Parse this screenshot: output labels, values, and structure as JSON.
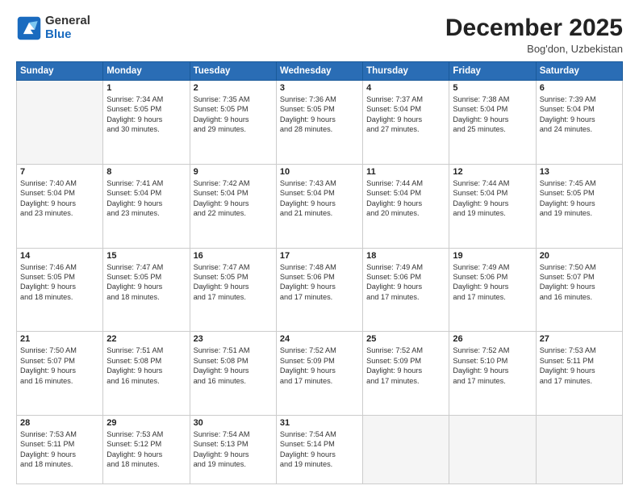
{
  "header": {
    "logo_general": "General",
    "logo_blue": "Blue",
    "month_title": "December 2025",
    "location": "Bog'don, Uzbekistan"
  },
  "days_of_week": [
    "Sunday",
    "Monday",
    "Tuesday",
    "Wednesday",
    "Thursday",
    "Friday",
    "Saturday"
  ],
  "weeks": [
    [
      {
        "day": "",
        "lines": [],
        "empty": true
      },
      {
        "day": "1",
        "lines": [
          "Sunrise: 7:34 AM",
          "Sunset: 5:05 PM",
          "Daylight: 9 hours",
          "and 30 minutes."
        ]
      },
      {
        "day": "2",
        "lines": [
          "Sunrise: 7:35 AM",
          "Sunset: 5:05 PM",
          "Daylight: 9 hours",
          "and 29 minutes."
        ]
      },
      {
        "day": "3",
        "lines": [
          "Sunrise: 7:36 AM",
          "Sunset: 5:05 PM",
          "Daylight: 9 hours",
          "and 28 minutes."
        ]
      },
      {
        "day": "4",
        "lines": [
          "Sunrise: 7:37 AM",
          "Sunset: 5:04 PM",
          "Daylight: 9 hours",
          "and 27 minutes."
        ]
      },
      {
        "day": "5",
        "lines": [
          "Sunrise: 7:38 AM",
          "Sunset: 5:04 PM",
          "Daylight: 9 hours",
          "and 25 minutes."
        ]
      },
      {
        "day": "6",
        "lines": [
          "Sunrise: 7:39 AM",
          "Sunset: 5:04 PM",
          "Daylight: 9 hours",
          "and 24 minutes."
        ]
      }
    ],
    [
      {
        "day": "7",
        "lines": [
          "Sunrise: 7:40 AM",
          "Sunset: 5:04 PM",
          "Daylight: 9 hours",
          "and 23 minutes."
        ]
      },
      {
        "day": "8",
        "lines": [
          "Sunrise: 7:41 AM",
          "Sunset: 5:04 PM",
          "Daylight: 9 hours",
          "and 23 minutes."
        ]
      },
      {
        "day": "9",
        "lines": [
          "Sunrise: 7:42 AM",
          "Sunset: 5:04 PM",
          "Daylight: 9 hours",
          "and 22 minutes."
        ]
      },
      {
        "day": "10",
        "lines": [
          "Sunrise: 7:43 AM",
          "Sunset: 5:04 PM",
          "Daylight: 9 hours",
          "and 21 minutes."
        ]
      },
      {
        "day": "11",
        "lines": [
          "Sunrise: 7:44 AM",
          "Sunset: 5:04 PM",
          "Daylight: 9 hours",
          "and 20 minutes."
        ]
      },
      {
        "day": "12",
        "lines": [
          "Sunrise: 7:44 AM",
          "Sunset: 5:04 PM",
          "Daylight: 9 hours",
          "and 19 minutes."
        ]
      },
      {
        "day": "13",
        "lines": [
          "Sunrise: 7:45 AM",
          "Sunset: 5:05 PM",
          "Daylight: 9 hours",
          "and 19 minutes."
        ]
      }
    ],
    [
      {
        "day": "14",
        "lines": [
          "Sunrise: 7:46 AM",
          "Sunset: 5:05 PM",
          "Daylight: 9 hours",
          "and 18 minutes."
        ]
      },
      {
        "day": "15",
        "lines": [
          "Sunrise: 7:47 AM",
          "Sunset: 5:05 PM",
          "Daylight: 9 hours",
          "and 18 minutes."
        ]
      },
      {
        "day": "16",
        "lines": [
          "Sunrise: 7:47 AM",
          "Sunset: 5:05 PM",
          "Daylight: 9 hours",
          "and 17 minutes."
        ]
      },
      {
        "day": "17",
        "lines": [
          "Sunrise: 7:48 AM",
          "Sunset: 5:06 PM",
          "Daylight: 9 hours",
          "and 17 minutes."
        ]
      },
      {
        "day": "18",
        "lines": [
          "Sunrise: 7:49 AM",
          "Sunset: 5:06 PM",
          "Daylight: 9 hours",
          "and 17 minutes."
        ]
      },
      {
        "day": "19",
        "lines": [
          "Sunrise: 7:49 AM",
          "Sunset: 5:06 PM",
          "Daylight: 9 hours",
          "and 17 minutes."
        ]
      },
      {
        "day": "20",
        "lines": [
          "Sunrise: 7:50 AM",
          "Sunset: 5:07 PM",
          "Daylight: 9 hours",
          "and 16 minutes."
        ]
      }
    ],
    [
      {
        "day": "21",
        "lines": [
          "Sunrise: 7:50 AM",
          "Sunset: 5:07 PM",
          "Daylight: 9 hours",
          "and 16 minutes."
        ]
      },
      {
        "day": "22",
        "lines": [
          "Sunrise: 7:51 AM",
          "Sunset: 5:08 PM",
          "Daylight: 9 hours",
          "and 16 minutes."
        ]
      },
      {
        "day": "23",
        "lines": [
          "Sunrise: 7:51 AM",
          "Sunset: 5:08 PM",
          "Daylight: 9 hours",
          "and 16 minutes."
        ]
      },
      {
        "day": "24",
        "lines": [
          "Sunrise: 7:52 AM",
          "Sunset: 5:09 PM",
          "Daylight: 9 hours",
          "and 17 minutes."
        ]
      },
      {
        "day": "25",
        "lines": [
          "Sunrise: 7:52 AM",
          "Sunset: 5:09 PM",
          "Daylight: 9 hours",
          "and 17 minutes."
        ]
      },
      {
        "day": "26",
        "lines": [
          "Sunrise: 7:52 AM",
          "Sunset: 5:10 PM",
          "Daylight: 9 hours",
          "and 17 minutes."
        ]
      },
      {
        "day": "27",
        "lines": [
          "Sunrise: 7:53 AM",
          "Sunset: 5:11 PM",
          "Daylight: 9 hours",
          "and 17 minutes."
        ]
      }
    ],
    [
      {
        "day": "28",
        "lines": [
          "Sunrise: 7:53 AM",
          "Sunset: 5:11 PM",
          "Daylight: 9 hours",
          "and 18 minutes."
        ]
      },
      {
        "day": "29",
        "lines": [
          "Sunrise: 7:53 AM",
          "Sunset: 5:12 PM",
          "Daylight: 9 hours",
          "and 18 minutes."
        ]
      },
      {
        "day": "30",
        "lines": [
          "Sunrise: 7:54 AM",
          "Sunset: 5:13 PM",
          "Daylight: 9 hours",
          "and 19 minutes."
        ]
      },
      {
        "day": "31",
        "lines": [
          "Sunrise: 7:54 AM",
          "Sunset: 5:14 PM",
          "Daylight: 9 hours",
          "and 19 minutes."
        ]
      },
      {
        "day": "",
        "lines": [],
        "empty": true
      },
      {
        "day": "",
        "lines": [],
        "empty": true
      },
      {
        "day": "",
        "lines": [],
        "empty": true
      }
    ]
  ]
}
